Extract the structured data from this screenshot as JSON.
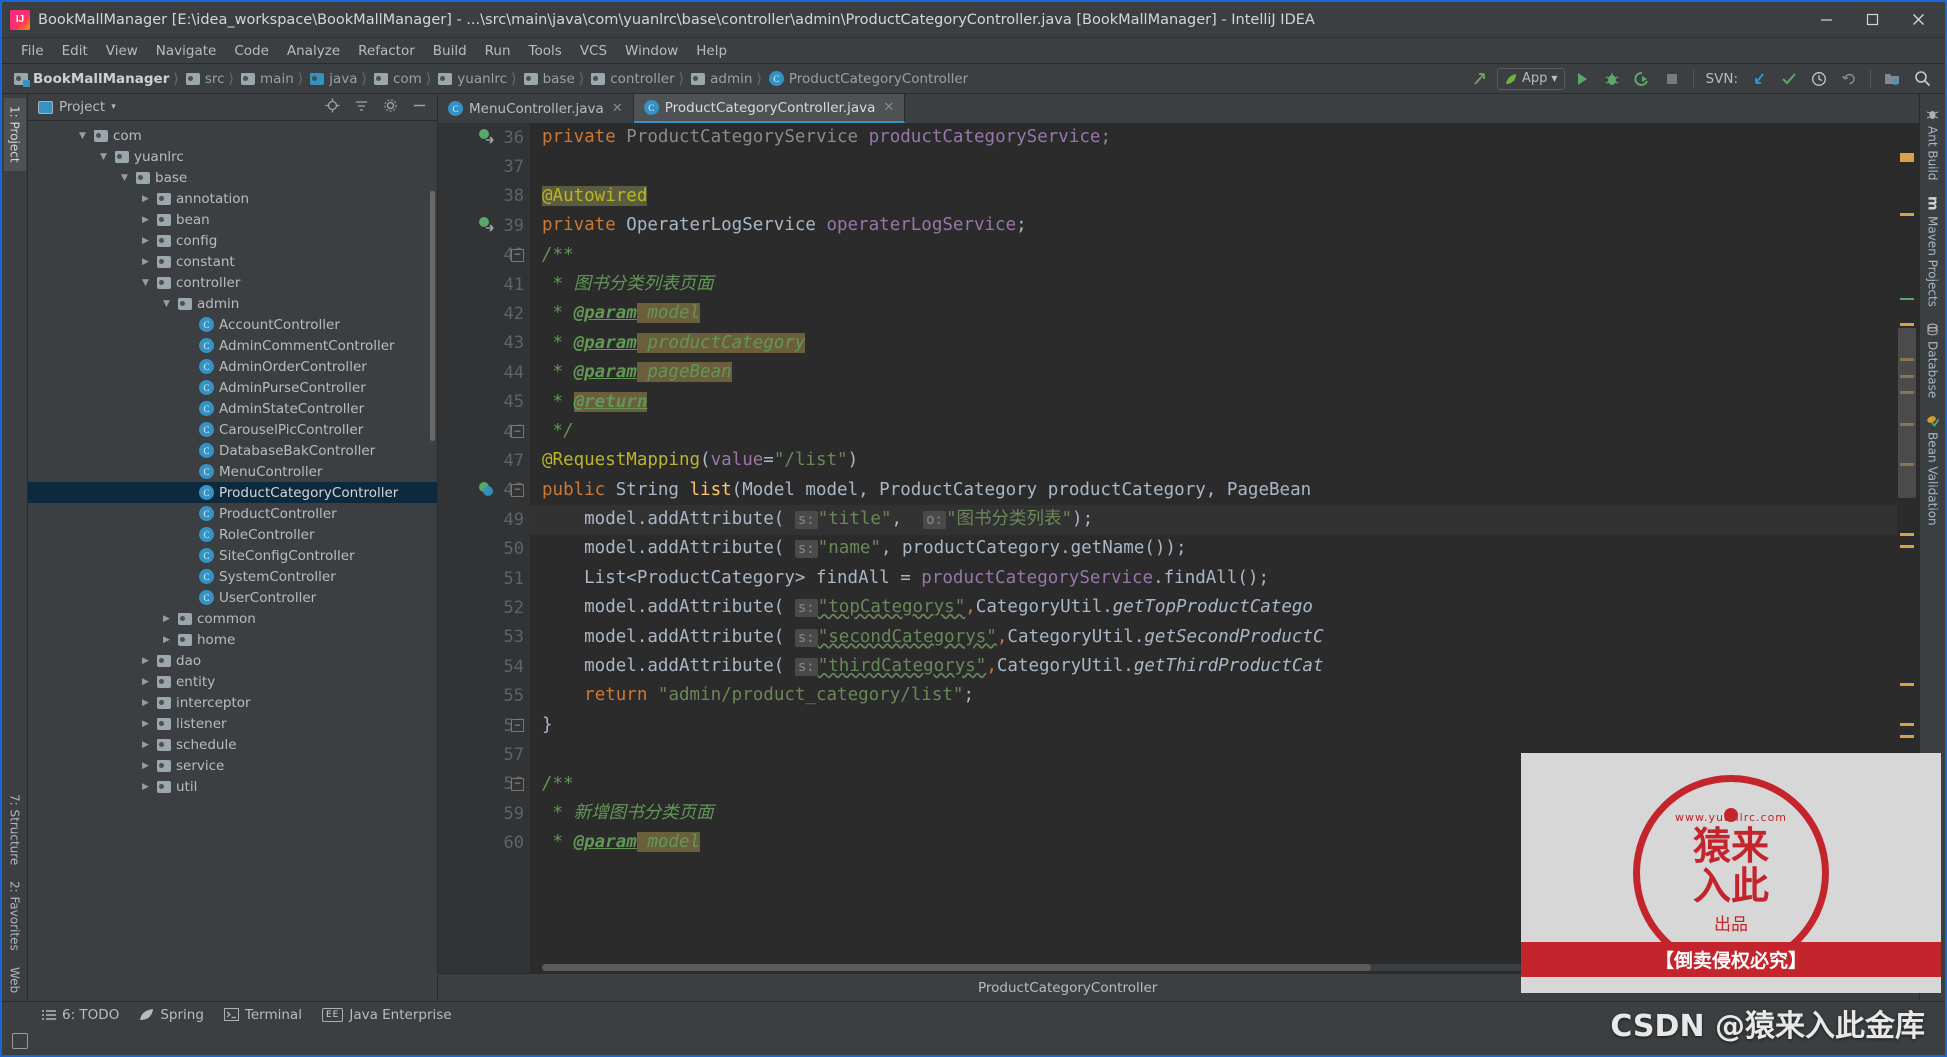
{
  "window": {
    "title": "BookMallManager [E:\\idea_workspace\\BookMallManager] - ...\\src\\main\\java\\com\\yuanlrc\\base\\controller\\admin\\ProductCategoryController.java [BookMallManager] - IntelliJ IDEA",
    "minimize_label": "─",
    "maximize_label": "❐",
    "close_label": "✕"
  },
  "menubar": {
    "items": [
      "File",
      "Edit",
      "View",
      "Navigate",
      "Code",
      "Analyze",
      "Refactor",
      "Build",
      "Run",
      "Tools",
      "VCS",
      "Window",
      "Help"
    ]
  },
  "breadcrumb": {
    "items": [
      {
        "label": "BookMallManager",
        "icon": "project-folder-icon",
        "kind": "project"
      },
      {
        "label": "src",
        "icon": "folder-icon",
        "kind": "grey"
      },
      {
        "label": "main",
        "icon": "folder-icon",
        "kind": "grey"
      },
      {
        "label": "java",
        "icon": "folder-icon",
        "kind": "blue"
      },
      {
        "label": "com",
        "icon": "folder-icon",
        "kind": "grey"
      },
      {
        "label": "yuanlrc",
        "icon": "folder-icon",
        "kind": "grey"
      },
      {
        "label": "base",
        "icon": "folder-icon",
        "kind": "grey"
      },
      {
        "label": "controller",
        "icon": "folder-icon",
        "kind": "grey"
      },
      {
        "label": "admin",
        "icon": "folder-icon",
        "kind": "grey"
      },
      {
        "label": "ProductCategoryController",
        "icon": "class-icon",
        "kind": "class"
      }
    ]
  },
  "toolbar_right": {
    "back_arrow": "back-arrow-icon",
    "run_config": "App",
    "run_caret": "▼",
    "run": "run-icon",
    "debug": "debug-icon",
    "coverage": "run-with-coverage-icon",
    "stop": "stop-icon",
    "svn_label": "SVN:",
    "svn_update": "update-project-icon",
    "svn_commit": "commit-icon",
    "svn_history": "history-icon",
    "svn_rollback": "rollback-icon",
    "project_structure": "project-structure-icon",
    "search": "search-everywhere-icon"
  },
  "left_rail": {
    "top_tab": "1: Project",
    "bottom_tabs": [
      "7: Structure",
      "2: Favorites",
      "Web"
    ]
  },
  "project_panel": {
    "header": "Project",
    "header_caret": "▾",
    "icons": [
      "locate-icon",
      "collapse-all-icon",
      "settings-icon",
      "hide-icon"
    ],
    "tree": [
      {
        "indent": 2,
        "arrow": "▼",
        "icon": "folder",
        "label": "com",
        "sel": false
      },
      {
        "indent": 3,
        "arrow": "▼",
        "icon": "folder",
        "label": "yuanlrc",
        "sel": false
      },
      {
        "indent": 4,
        "arrow": "▼",
        "icon": "folder",
        "label": "base",
        "sel": false
      },
      {
        "indent": 5,
        "arrow": "▶",
        "icon": "folder",
        "label": "annotation",
        "sel": false
      },
      {
        "indent": 5,
        "arrow": "▶",
        "icon": "folder",
        "label": "bean",
        "sel": false
      },
      {
        "indent": 5,
        "arrow": "▶",
        "icon": "folder",
        "label": "config",
        "sel": false
      },
      {
        "indent": 5,
        "arrow": "▶",
        "icon": "folder",
        "label": "constant",
        "sel": false
      },
      {
        "indent": 5,
        "arrow": "▼",
        "icon": "folder",
        "label": "controller",
        "sel": false
      },
      {
        "indent": 6,
        "arrow": "▼",
        "icon": "folder",
        "label": "admin",
        "sel": false
      },
      {
        "indent": 7,
        "arrow": "",
        "icon": "class",
        "label": "AccountController",
        "sel": false
      },
      {
        "indent": 7,
        "arrow": "",
        "icon": "class",
        "label": "AdminCommentController",
        "sel": false
      },
      {
        "indent": 7,
        "arrow": "",
        "icon": "class",
        "label": "AdminOrderController",
        "sel": false
      },
      {
        "indent": 7,
        "arrow": "",
        "icon": "class",
        "label": "AdminPurseController",
        "sel": false
      },
      {
        "indent": 7,
        "arrow": "",
        "icon": "class",
        "label": "AdminStateController",
        "sel": false
      },
      {
        "indent": 7,
        "arrow": "",
        "icon": "class",
        "label": "CarouselPicController",
        "sel": false
      },
      {
        "indent": 7,
        "arrow": "",
        "icon": "class",
        "label": "DatabaseBakController",
        "sel": false
      },
      {
        "indent": 7,
        "arrow": "",
        "icon": "class",
        "label": "MenuController",
        "sel": false
      },
      {
        "indent": 7,
        "arrow": "",
        "icon": "class",
        "label": "ProductCategoryController",
        "sel": true
      },
      {
        "indent": 7,
        "arrow": "",
        "icon": "class",
        "label": "ProductController",
        "sel": false
      },
      {
        "indent": 7,
        "arrow": "",
        "icon": "class",
        "label": "RoleController",
        "sel": false
      },
      {
        "indent": 7,
        "arrow": "",
        "icon": "class",
        "label": "SiteConfigController",
        "sel": false
      },
      {
        "indent": 7,
        "arrow": "",
        "icon": "class",
        "label": "SystemController",
        "sel": false
      },
      {
        "indent": 7,
        "arrow": "",
        "icon": "class",
        "label": "UserController",
        "sel": false
      },
      {
        "indent": 6,
        "arrow": "▶",
        "icon": "folder",
        "label": "common",
        "sel": false
      },
      {
        "indent": 6,
        "arrow": "▶",
        "icon": "folder",
        "label": "home",
        "sel": false
      },
      {
        "indent": 5,
        "arrow": "▶",
        "icon": "folder",
        "label": "dao",
        "sel": false
      },
      {
        "indent": 5,
        "arrow": "▶",
        "icon": "folder",
        "label": "entity",
        "sel": false
      },
      {
        "indent": 5,
        "arrow": "▶",
        "icon": "folder",
        "label": "interceptor",
        "sel": false
      },
      {
        "indent": 5,
        "arrow": "▶",
        "icon": "folder",
        "label": "listener",
        "sel": false
      },
      {
        "indent": 5,
        "arrow": "▶",
        "icon": "folder",
        "label": "schedule",
        "sel": false
      },
      {
        "indent": 5,
        "arrow": "▶",
        "icon": "folder",
        "label": "service",
        "sel": false
      },
      {
        "indent": 5,
        "arrow": "▶",
        "icon": "folder",
        "label": "util",
        "sel": false
      }
    ]
  },
  "editor": {
    "tabs": [
      {
        "label": "MenuController.java",
        "active": false,
        "close": "✕"
      },
      {
        "label": "ProductCategoryController.java",
        "active": true,
        "close": "✕"
      }
    ],
    "first_line_number": 36,
    "lines": [
      {
        "n": 36,
        "text": "private ProductCategoryService productCategoryService;",
        "partial": true
      },
      {
        "n": 37,
        "text": ""
      },
      {
        "n": 38,
        "text": "@Autowired"
      },
      {
        "n": 39,
        "text": "private OperaterLogService operaterLogService;"
      },
      {
        "n": 40,
        "text": "/**"
      },
      {
        "n": 41,
        "text": " * 图书分类列表页面"
      },
      {
        "n": 42,
        "text": " * @param model"
      },
      {
        "n": 43,
        "text": " * @param productCategory"
      },
      {
        "n": 44,
        "text": " * @param pageBean"
      },
      {
        "n": 45,
        "text": " * @return"
      },
      {
        "n": 46,
        "text": " */"
      },
      {
        "n": 47,
        "text": "@RequestMapping(value=\"/list\")"
      },
      {
        "n": 48,
        "text": "public String list(Model model, ProductCategory productCategory, PageBean"
      },
      {
        "n": 49,
        "text": "    model.addAttribute( s: \"title\",  o: \"图书分类列表\");"
      },
      {
        "n": 50,
        "text": "    model.addAttribute( s: \"name\", productCategory.getName());"
      },
      {
        "n": 51,
        "text": "    List<ProductCategory> findAll = productCategoryService.findAll();"
      },
      {
        "n": 52,
        "text": "    model.addAttribute( s: \"topCategorys\",CategoryUtil.getTopProductCatego"
      },
      {
        "n": 53,
        "text": "    model.addAttribute( s: \"secondCategorys\",CategoryUtil.getSecondProductC"
      },
      {
        "n": 54,
        "text": "    model.addAttribute( s: \"thirdCategorys\",CategoryUtil.getThirdProductCat"
      },
      {
        "n": 55,
        "text": "    return \"admin/product_category/list\";"
      },
      {
        "n": 56,
        "text": "}"
      },
      {
        "n": 57,
        "text": ""
      },
      {
        "n": 58,
        "text": "/**"
      },
      {
        "n": 59,
        "text": " * 新增图书分类页面"
      },
      {
        "n": 60,
        "text": " * @param model"
      }
    ]
  },
  "bottom_breadcrumb": {
    "text": "ProductCategoryController"
  },
  "right_rail": {
    "tabs": [
      "Ant Build",
      "Maven Projects",
      "Database",
      "Bean Validation"
    ]
  },
  "toolwindow_bar": {
    "items": [
      {
        "label": "6: TODO",
        "icon": "todo-icon"
      },
      {
        "label": "Spring",
        "icon": "spring-leaf-icon"
      },
      {
        "label": "Terminal",
        "icon": "terminal-icon"
      },
      {
        "label": "Java Enterprise",
        "icon": "java-ee-icon"
      }
    ]
  },
  "watermark": {
    "stamp_url": "www.yuanlrc.com",
    "stamp_line1": "猿来",
    "stamp_line2": "入此",
    "stamp_sub": "出品",
    "warning": "【倒卖侵权必究】",
    "csdn": "CSDN @猿来入此金库"
  },
  "colors": {
    "accent": "#3592c4",
    "window_border": "#1a66d6",
    "panel_bg": "#3c3f41",
    "editor_bg": "#2b2b2b",
    "selection": "#0d293e"
  }
}
